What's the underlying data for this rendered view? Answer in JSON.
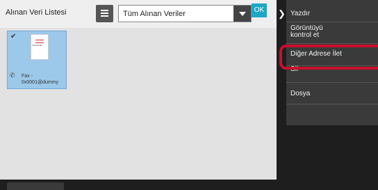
{
  "header": {
    "title": "Alınan Veri Listesi",
    "ok_label": "OK"
  },
  "filter": {
    "selected": "Tüm Alınan Veriler"
  },
  "items": [
    {
      "thumb_title": "Thumbnail",
      "label": "Fax - 0x0001@dummy"
    }
  ],
  "menu": [
    "Yazdır",
    "Görüntüyü kontrol et",
    "Diğer Adrese İlet",
    "Sil",
    "Dosya"
  ],
  "colors": {
    "highlight": "#c8102e",
    "ok_button": "#1ea7c5",
    "selected_tile": "#9cc8ea"
  }
}
